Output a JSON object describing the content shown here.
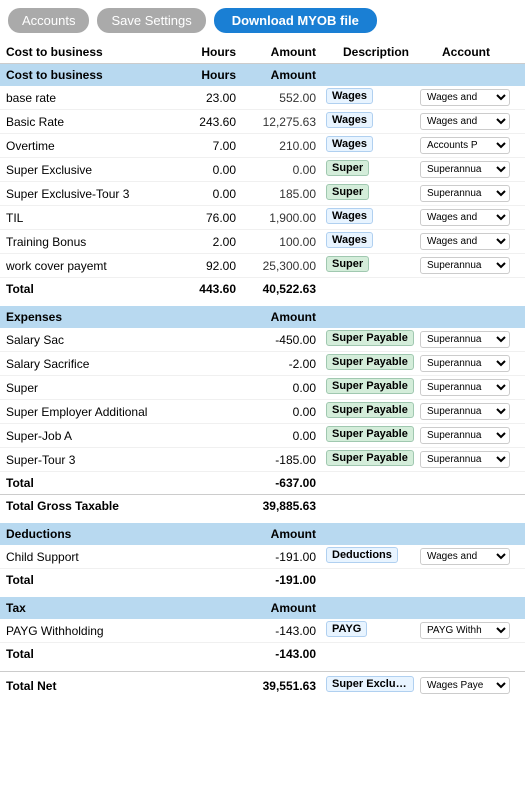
{
  "topbar": {
    "accounts_label": "Accounts",
    "save_label": "Save Settings",
    "download_label": "Download MYOB file"
  },
  "col_headers": {
    "cost": "Cost to business",
    "hours": "Hours",
    "amount": "Amount",
    "description": "Description",
    "account": "Account"
  },
  "cost_to_business": {
    "header": "Cost to business",
    "hours_header": "Hours",
    "amount_header": "Amount",
    "rows": [
      {
        "label": "base rate",
        "hours": "23.00",
        "amount": "552.00",
        "desc": "Wages",
        "desc_type": "wages",
        "account": "Wages and",
        "account_full": "Wages and Salaries"
      },
      {
        "label": "Basic Rate",
        "hours": "243.60",
        "amount": "12,275.63",
        "desc": "Wages",
        "desc_type": "wages",
        "account": "Wages and",
        "account_full": "Wages and Salaries"
      },
      {
        "label": "Overtime",
        "hours": "7.00",
        "amount": "210.00",
        "desc": "Wages",
        "desc_type": "wages",
        "account": "Accounts Pa",
        "account_full": "Accounts Payable"
      },
      {
        "label": "Super Exclusive",
        "hours": "0.00",
        "amount": "0.00",
        "desc": "Super",
        "desc_type": "super",
        "account": "Superannua",
        "account_full": "Superannuation"
      },
      {
        "label": "Super Exclusive-Tour 3",
        "hours": "0.00",
        "amount": "185.00",
        "desc": "Super",
        "desc_type": "super",
        "account": "Superannua",
        "account_full": "Superannuation"
      },
      {
        "label": "TIL",
        "hours": "76.00",
        "amount": "1,900.00",
        "desc": "Wages",
        "desc_type": "wages",
        "account": "Wages and",
        "account_full": "Wages and Salaries"
      },
      {
        "label": "Training Bonus",
        "hours": "2.00",
        "amount": "100.00",
        "desc": "Wages",
        "desc_type": "wages",
        "account": "Wages and",
        "account_full": "Wages and Salaries"
      },
      {
        "label": "work cover payemt",
        "hours": "92.00",
        "amount": "25,300.00",
        "desc": "Super",
        "desc_type": "super",
        "account": "Superannua",
        "account_full": "Superannuation"
      }
    ],
    "total_label": "Total",
    "total_hours": "443.60",
    "total_amount": "40,522.63"
  },
  "expenses": {
    "header": "Expenses",
    "amount_header": "Amount",
    "rows": [
      {
        "label": "Salary Sac",
        "amount": "-450.00",
        "desc": "Super Payable",
        "desc_type": "super-payable",
        "account": "Superannua",
        "account_full": "Superannuation"
      },
      {
        "label": "Salary Sacrifice",
        "amount": "-2.00",
        "desc": "Super Payable",
        "desc_type": "super-payable",
        "account": "Superannua",
        "account_full": "Superannuation"
      },
      {
        "label": "Super",
        "amount": "0.00",
        "desc": "Super Payable",
        "desc_type": "super-payable",
        "account": "Superannua",
        "account_full": "Superannuation"
      },
      {
        "label": "Super Employer Additional",
        "amount": "0.00",
        "desc": "Super Payable",
        "desc_type": "super-payable",
        "account": "Superannua",
        "account_full": "Superannuation"
      },
      {
        "label": "Super-Job A",
        "amount": "0.00",
        "desc": "Super Payable",
        "desc_type": "super-payable",
        "account": "Superannua",
        "account_full": "Superannuation"
      },
      {
        "label": "Super-Tour 3",
        "amount": "-185.00",
        "desc": "Super Payable",
        "desc_type": "super-payable",
        "account": "Superannua",
        "account_full": "Superannuation"
      }
    ],
    "total_label": "Total",
    "total_amount": "-637.00",
    "gross_label": "Total Gross Taxable",
    "gross_amount": "39,885.63"
  },
  "deductions": {
    "header": "Deductions",
    "amount_header": "Amount",
    "rows": [
      {
        "label": "Child Support",
        "amount": "-191.00",
        "desc": "Deductions",
        "desc_type": "deductions",
        "account": "Wages and",
        "account_full": "Wages and Salaries"
      }
    ],
    "total_label": "Total",
    "total_amount": "-191.00"
  },
  "tax": {
    "header": "Tax",
    "amount_header": "Amount",
    "rows": [
      {
        "label": "PAYG Withholding",
        "amount": "-143.00",
        "desc": "PAYG",
        "desc_type": "payg",
        "account": "PAYG Withh",
        "account_full": "PAYG Withholding"
      }
    ],
    "total_label": "Total",
    "total_amount": "-143.00"
  },
  "total_net": {
    "label": "Total Net",
    "amount": "39,551.63",
    "desc": "Super Exclusive",
    "account": "Wages Paye"
  },
  "account_options": [
    "Wages and Salaries",
    "Accounts Payable",
    "Superannuation",
    "PAYG Withholding",
    "Wages Payee"
  ]
}
